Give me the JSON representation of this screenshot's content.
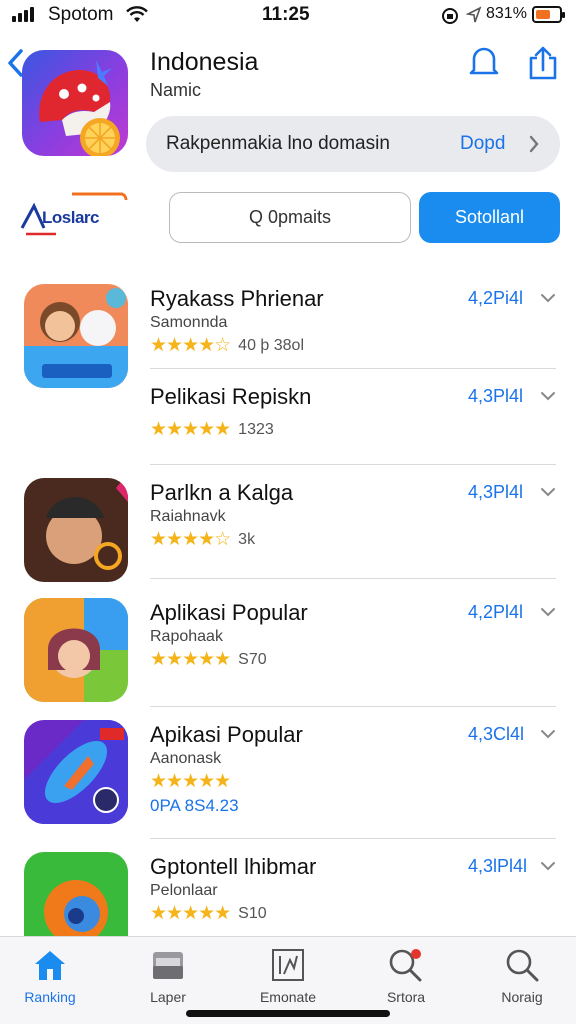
{
  "status_bar": {
    "carrier": "Spotom",
    "time": "11:25",
    "battery_percent": "831%",
    "battery_level": 0.5,
    "battery_color": "#f07020"
  },
  "header": {
    "title": "Indonesia",
    "subtitle": "Namic",
    "icons": [
      "back-chevron-icon",
      "bell-icon",
      "share-icon"
    ]
  },
  "domain_bar": {
    "text": "Rakpenmakia lno domasin",
    "action": "Dopd"
  },
  "toolbar": {
    "logo_text": "Loslarc",
    "search_label": "Q 0pmaits",
    "primary_label": "Sotollanl",
    "accent": "#1a8cf0"
  },
  "apps": [
    {
      "name": "Ryakass Phrienar",
      "developer": "Samonnda",
      "stars": "★★★★☆",
      "count": "40 þ 38ol",
      "rating": "4,2Pi4l"
    },
    {
      "name": "Pelikasi Repiskn",
      "developer": "",
      "stars": "★★★★★",
      "count": "1323",
      "rating": "4,3Pl4l"
    },
    {
      "name": "Parlkn a Kalga",
      "developer": "Raiahnavk",
      "stars": "★★★★☆",
      "count": "3k",
      "rating": "4,3Pl4l"
    },
    {
      "name": "Aplikasi Popular",
      "developer": "Rapohaak",
      "stars": "★★★★★",
      "count": "S70",
      "rating": "4,2Pl4l"
    },
    {
      "name": "Apikasi Popular",
      "developer": "Aanonask",
      "stars": "★★★★★",
      "count": "",
      "price": "0PA 8S4.23",
      "rating": "4,3Cl4l"
    },
    {
      "name": "Gptontell lhibmar",
      "developer": "Pelonlaar",
      "stars": "★★★★★",
      "count": "S10",
      "rating": "4,3lPl4l"
    }
  ],
  "tabs": [
    {
      "label": "Ranking",
      "icon": "house-icon",
      "active": true
    },
    {
      "label": "Laper",
      "icon": "folder-icon",
      "active": false
    },
    {
      "label": "Emonate",
      "icon": "chart-frame-icon",
      "active": false
    },
    {
      "label": "Srtora",
      "icon": "search-badge-icon",
      "active": false
    },
    {
      "label": "Noraig",
      "icon": "search-icon",
      "active": false
    }
  ]
}
